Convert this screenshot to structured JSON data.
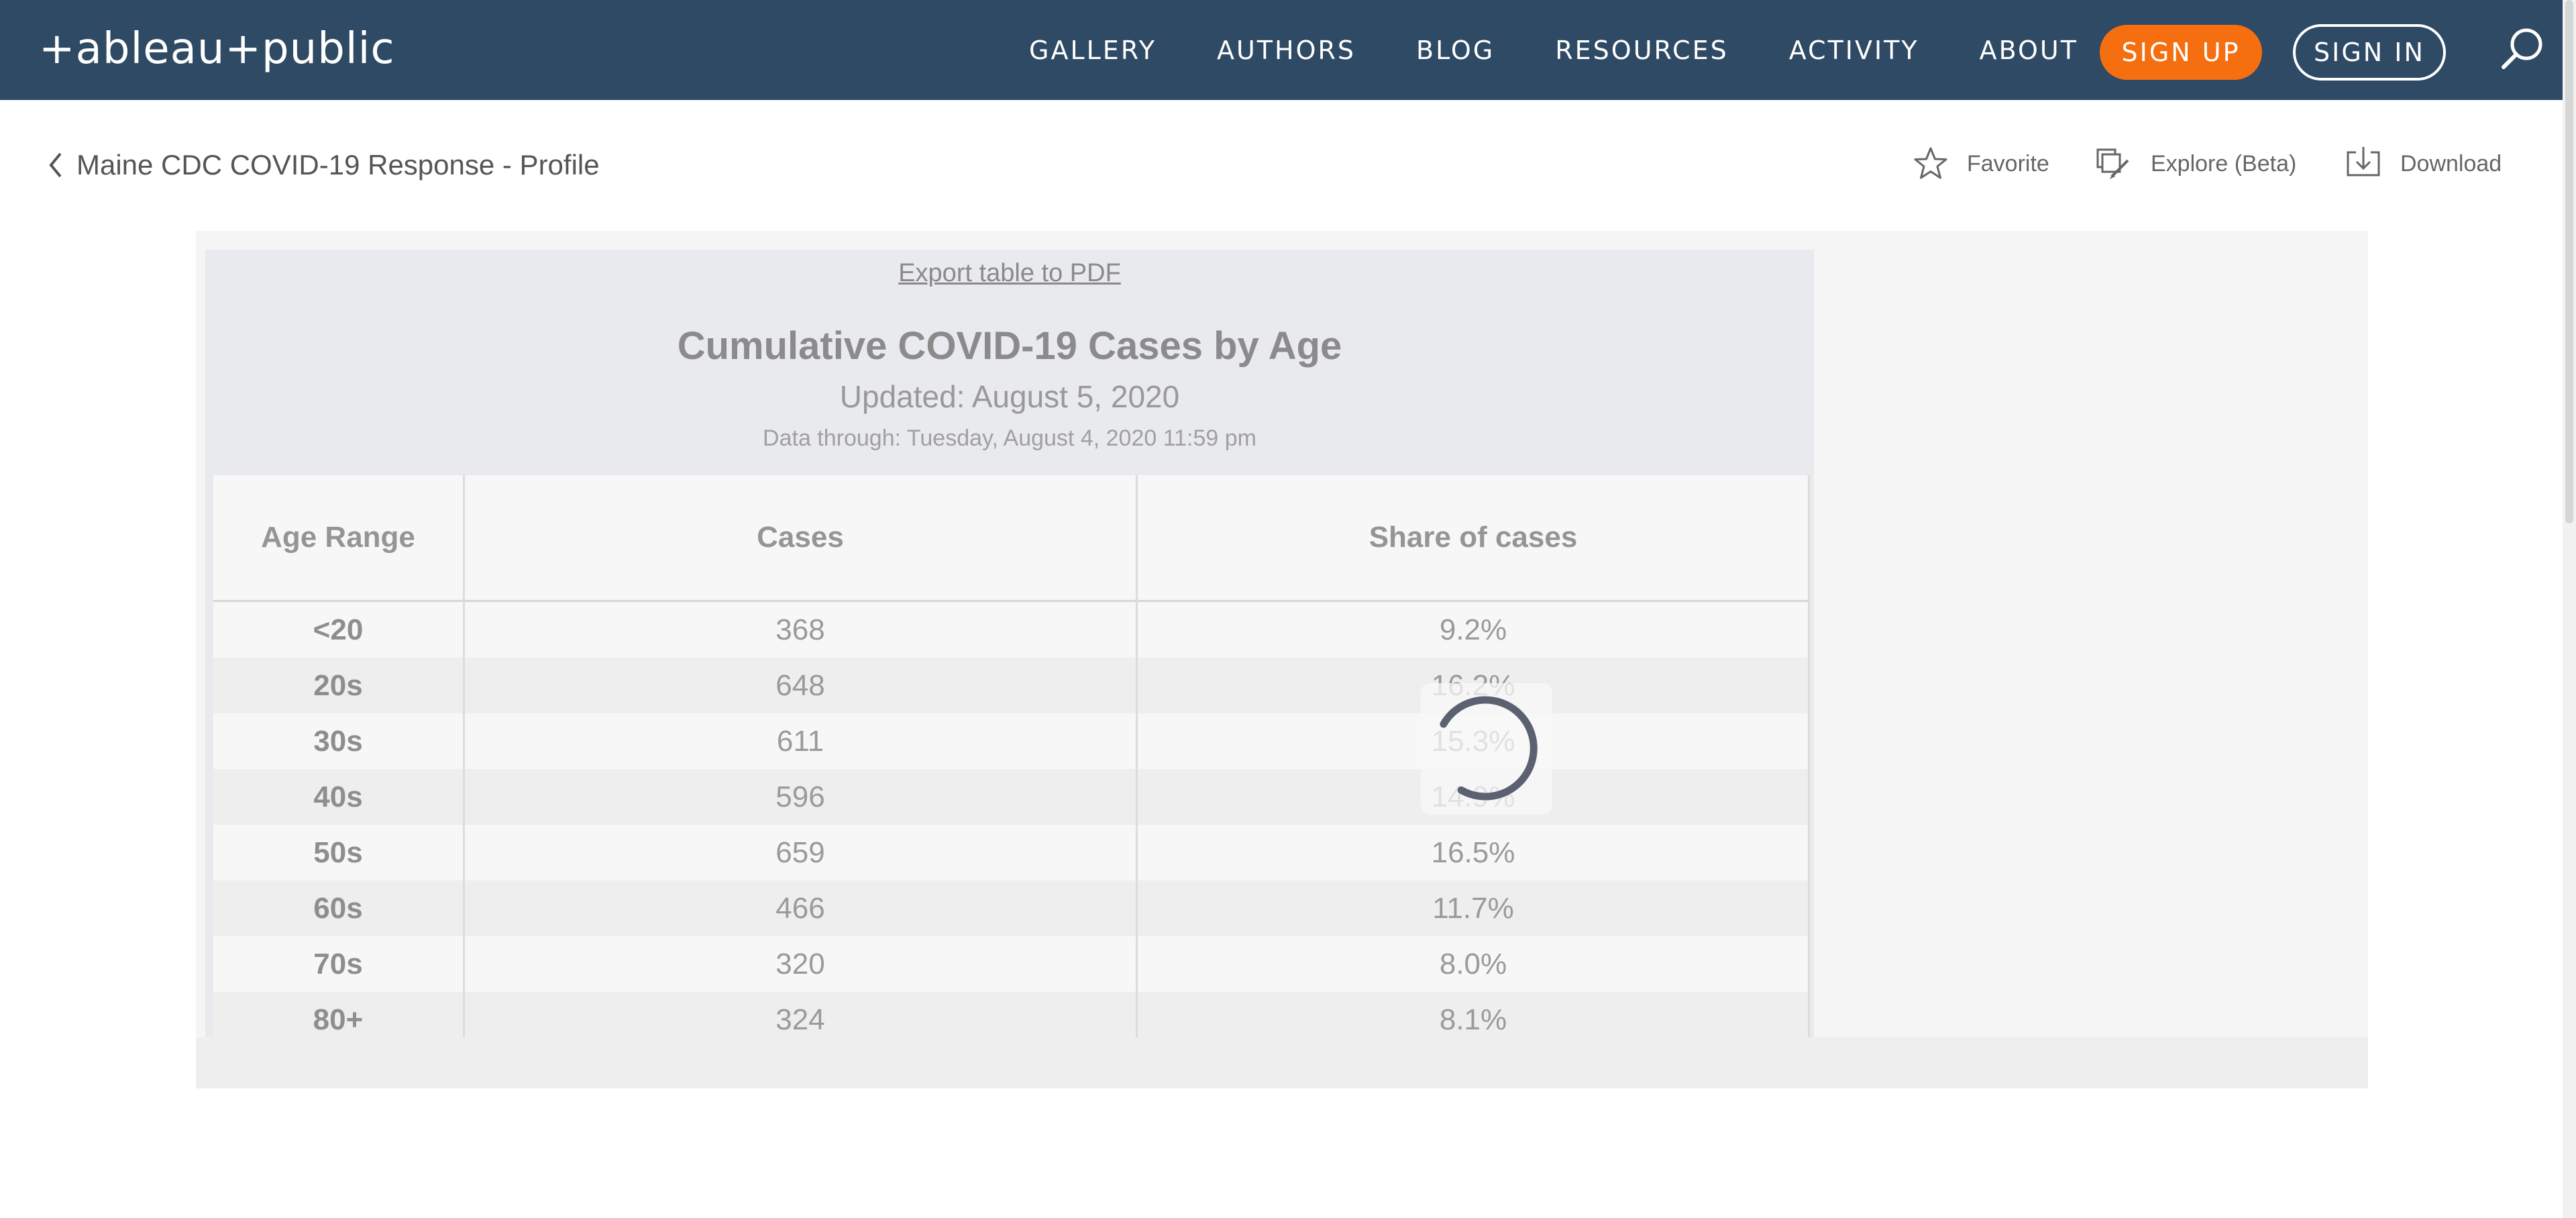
{
  "nav": {
    "logo": "+ableau+public",
    "links": [
      "GALLERY",
      "AUTHORS",
      "BLOG",
      "RESOURCES",
      "ACTIVITY",
      "ABOUT"
    ],
    "signup": "SIGN UP",
    "signin": "SIGN IN",
    "search_icon": "search-icon"
  },
  "subheader": {
    "back_label": "Maine CDC COVID-19 Response - Profile",
    "actions": {
      "favorite": "Favorite",
      "explore": "Explore (Beta)",
      "download": "Download"
    }
  },
  "viz": {
    "export_link": "Export table to PDF",
    "title": "Cumulative COVID-19 Cases by Age",
    "updated": "Updated: August 5, 2020",
    "data_through": "Data through: Tuesday, August 4, 2020 11:59 pm",
    "table": {
      "headers": [
        "Age Range",
        "Cases",
        "Share of cases"
      ],
      "rows": [
        [
          "<20",
          "368",
          "9.2%"
        ],
        [
          "20s",
          "648",
          "16.2%"
        ],
        [
          "30s",
          "611",
          "15.3%"
        ],
        [
          "40s",
          "596",
          "14.9%"
        ],
        [
          "50s",
          "659",
          "16.5%"
        ],
        [
          "60s",
          "466",
          "11.7%"
        ],
        [
          "70s",
          "320",
          "8.0%"
        ],
        [
          "80+",
          "324",
          "8.1%"
        ]
      ]
    },
    "loading": true
  },
  "colors": {
    "nav_bg": "#2f4a64",
    "signup_bg": "#f56f11",
    "viz_bg": "#e9eaee"
  }
}
